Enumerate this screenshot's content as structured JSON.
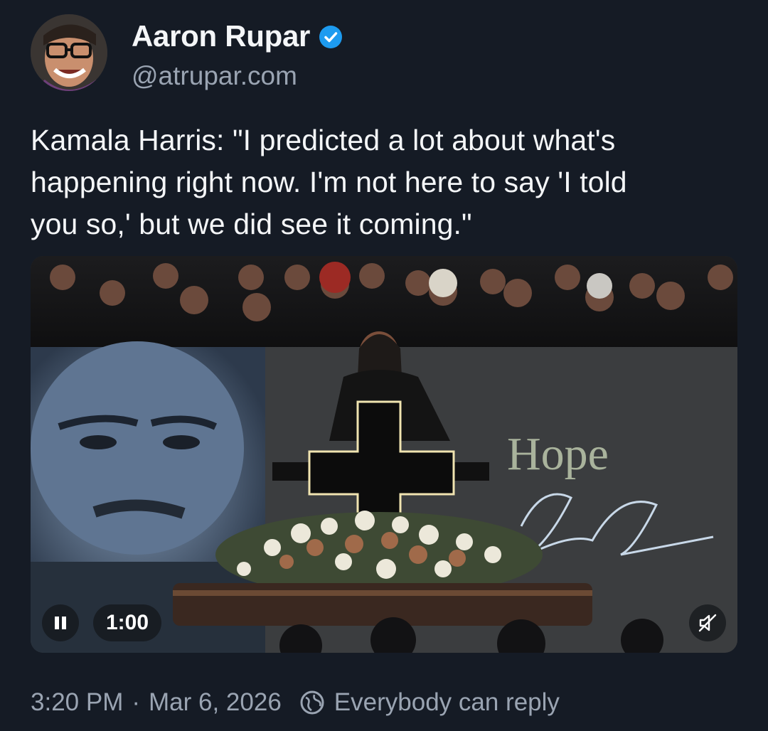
{
  "author": {
    "display_name": "Aaron Rupar",
    "handle": "@atrupar.com",
    "verified_icon": "verified-badge-icon",
    "avatar_icon": "avatar"
  },
  "post": {
    "text": "Kamala Harris: \"I predicted a lot about what's\nhappening right now. I'm not here to say 'I told\nyou so,' but we did see it coming.\""
  },
  "video": {
    "elapsed": "1:00",
    "pause_icon": "pause-icon",
    "mute_icon": "muted-speaker-icon",
    "backdrop_text": "Hope"
  },
  "footer": {
    "time": "3:20 PM",
    "separator": "·",
    "date": "Mar 6, 2026",
    "reply_setting": "Everybody can reply",
    "reply_icon": "globe-icon"
  },
  "colors": {
    "background": "#151b25",
    "primary_text": "#f4f6f8",
    "secondary_text": "#9aa4b2",
    "verified_blue": "#1d9bf0"
  }
}
